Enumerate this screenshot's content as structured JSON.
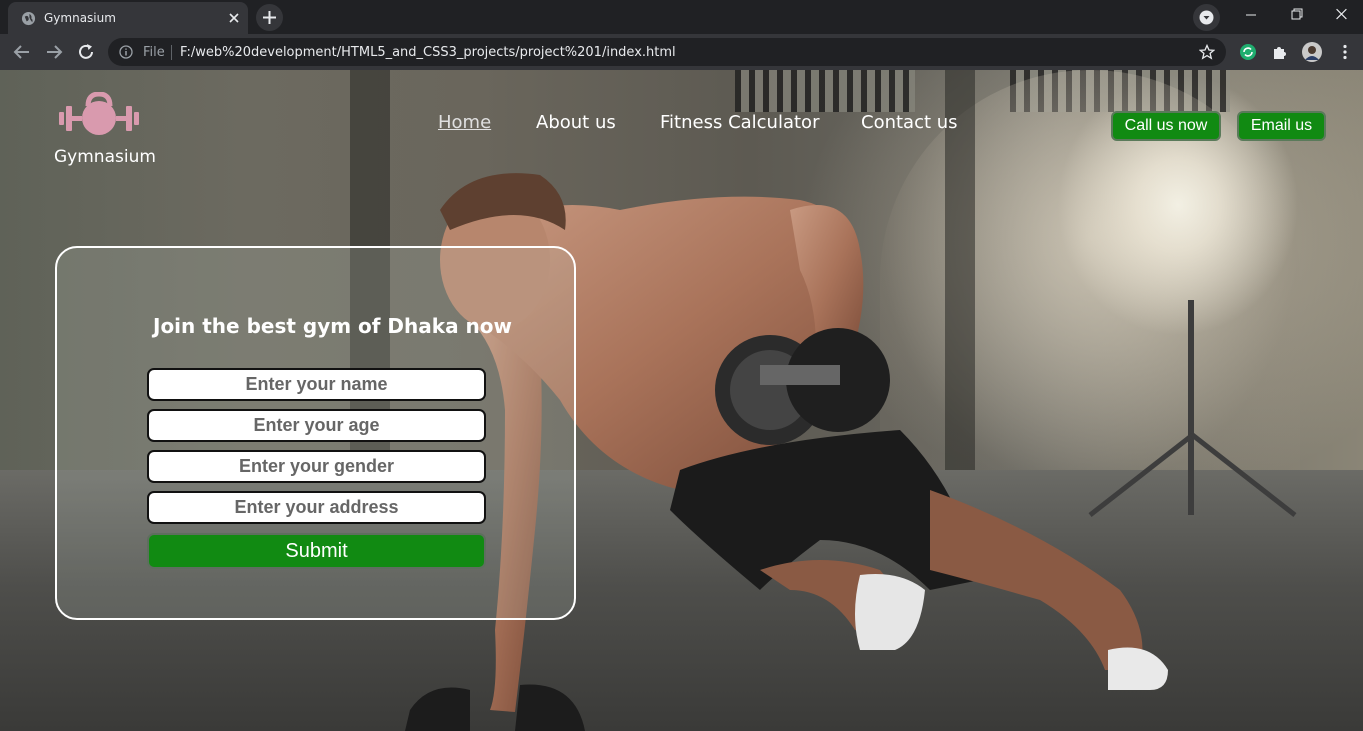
{
  "browser": {
    "tab_title": "Gymnasium",
    "omnibox_security_label": "File",
    "url": "F:/web%20development/HTML5_and_CSS3_projects/project%201/index.html"
  },
  "site": {
    "logo_text": "Gymnasium",
    "nav": [
      {
        "label": "Home",
        "active": true
      },
      {
        "label": "About us",
        "active": false
      },
      {
        "label": "Fitness Calculator",
        "active": false
      },
      {
        "label": "Contact us",
        "active": false
      }
    ],
    "call_button": "Call us now",
    "email_button": "Email us",
    "accent_color": "#118a12",
    "logo_color": "#d99aae"
  },
  "form": {
    "title": "Join the best gym of Dhaka now",
    "name_placeholder": "Enter your name",
    "age_placeholder": "Enter your age",
    "gender_placeholder": "Enter your gender",
    "address_placeholder": "Enter your address",
    "submit_label": "Submit"
  }
}
